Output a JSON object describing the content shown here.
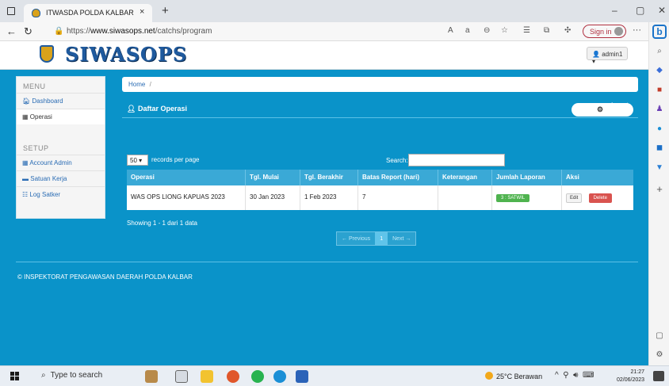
{
  "browser": {
    "tab_title": "ITWASDA POLDA KALBAR",
    "tab_close": "×",
    "new_tab": "+",
    "url_prefix": "https://",
    "url_host": "www.siwasops.net",
    "url_path": "/catchs/program",
    "signin_label": "Sign in",
    "more": "···",
    "minimize": "–",
    "restore": "▢",
    "close": "✕"
  },
  "site": {
    "title": "SIWASOPS",
    "user_label": "admin1"
  },
  "sidebar": {
    "menu_heading": "MENU",
    "menu_items": [
      {
        "label": "Dashboard",
        "icon": "home-icon"
      },
      {
        "label": "Operasi",
        "icon": "grid-icon"
      }
    ],
    "setup_heading": "SETUP",
    "setup_items": [
      {
        "label": "Account Admin",
        "icon": "grid-icon"
      },
      {
        "label": "Satuan Kerja",
        "icon": "card-icon"
      },
      {
        "label": "Log Satker",
        "icon": "log-icon"
      }
    ]
  },
  "breadcrumb": {
    "home": "Home",
    "sep": "/"
  },
  "panel": {
    "title": "Daftar Operasi",
    "input_label": "Input"
  },
  "table_controls": {
    "page_length": "50",
    "length_label": "records per page",
    "search_label": "Search:"
  },
  "table": {
    "headers": [
      "Operasi",
      "Tgl. Mulai",
      "Tgl. Berakhir",
      "Batas Report (hari)",
      "Keterangan",
      "Jumlah Laporan",
      "Aksi"
    ],
    "rows": [
      {
        "operasi": "WAS OPS LIONG KAPUAS 2023",
        "tgl_mulai": "30 Jan 2023",
        "tgl_berakhir": "1 Feb 2023",
        "batas_report": "7",
        "keterangan": "",
        "jumlah_laporan": "3 : SATWIL",
        "edit": "Edit",
        "delete": "Delete"
      }
    ]
  },
  "pagination": {
    "info": "Showing 1 - 1 dari 1 data",
    "previous": "← Previous",
    "current": "1",
    "next": "Next →"
  },
  "footer": {
    "text": "© INSPEKTORAT PENGAWASAN DAERAH POLDA KALBAR"
  },
  "taskbar": {
    "search_placeholder": "Type to search",
    "weather": "25°C  Berawan",
    "time": "21:27",
    "date": "02/06/2023"
  },
  "colors": {
    "main_bg": "#0a93c9",
    "table_header": "#3aa9d6",
    "satwil_badge": "#4fb34f",
    "delete_button": "#d9534f",
    "brand": "#1f5a9e"
  }
}
